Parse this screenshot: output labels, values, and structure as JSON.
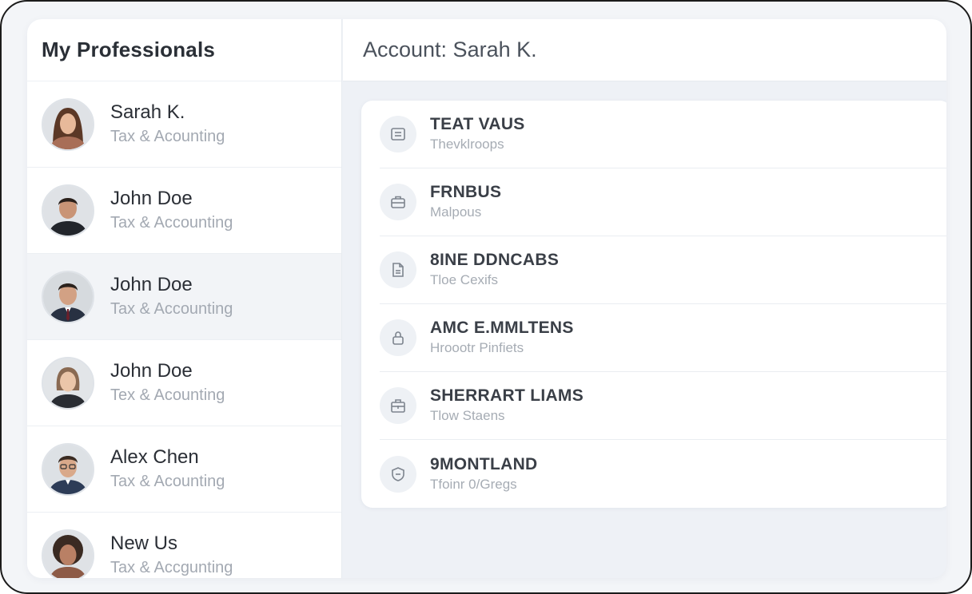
{
  "sidebar": {
    "title": "My Professionals",
    "items": [
      {
        "name": "Sarah K.",
        "role": "Tax & Acounting",
        "avatar": "woman-long-hair"
      },
      {
        "name": "John Doe",
        "role": "Tax & Accounting",
        "avatar": "man-dark-hair"
      },
      {
        "name": "John Doe",
        "role": "Tax & Accounting",
        "avatar": "man-suit",
        "selected": true
      },
      {
        "name": "John Doe",
        "role": "Tex & Acounting",
        "avatar": "woman-pulled-hair"
      },
      {
        "name": "Alex Chen",
        "role": "Tax & Acounting",
        "avatar": "man-glasses"
      },
      {
        "name": "New Us",
        "role": "Tax & Accgunting",
        "avatar": "woman-curly-hair"
      }
    ]
  },
  "main": {
    "account_title": "Account: Sarah K.",
    "rows": [
      {
        "title": "TEAT VAUS",
        "subtitle": "Thevklroops",
        "icon": "document-icon"
      },
      {
        "title": "FRNBUS",
        "subtitle": "Malpous",
        "icon": "briefcase-icon"
      },
      {
        "title": "8INE DDNCABS",
        "subtitle": "Tloe Cexifs",
        "icon": "file-icon"
      },
      {
        "title": "AMC E.MMLTENS",
        "subtitle": "Hroootr Pinfiets",
        "icon": "lock-icon"
      },
      {
        "title": "SHERRART LIAMS",
        "subtitle": "Tlow Staens",
        "icon": "building-icon"
      },
      {
        "title": "9MONTLAND",
        "subtitle": "Tfoinr 0/Gregs",
        "icon": "shield-icon"
      }
    ]
  },
  "colors": {
    "frame_border": "#1b1b1b",
    "app_background": "#eef1f6",
    "selected_row": "#f2f4f7",
    "title_text": "#2a2f36",
    "muted_text": "#a3a9b2"
  }
}
